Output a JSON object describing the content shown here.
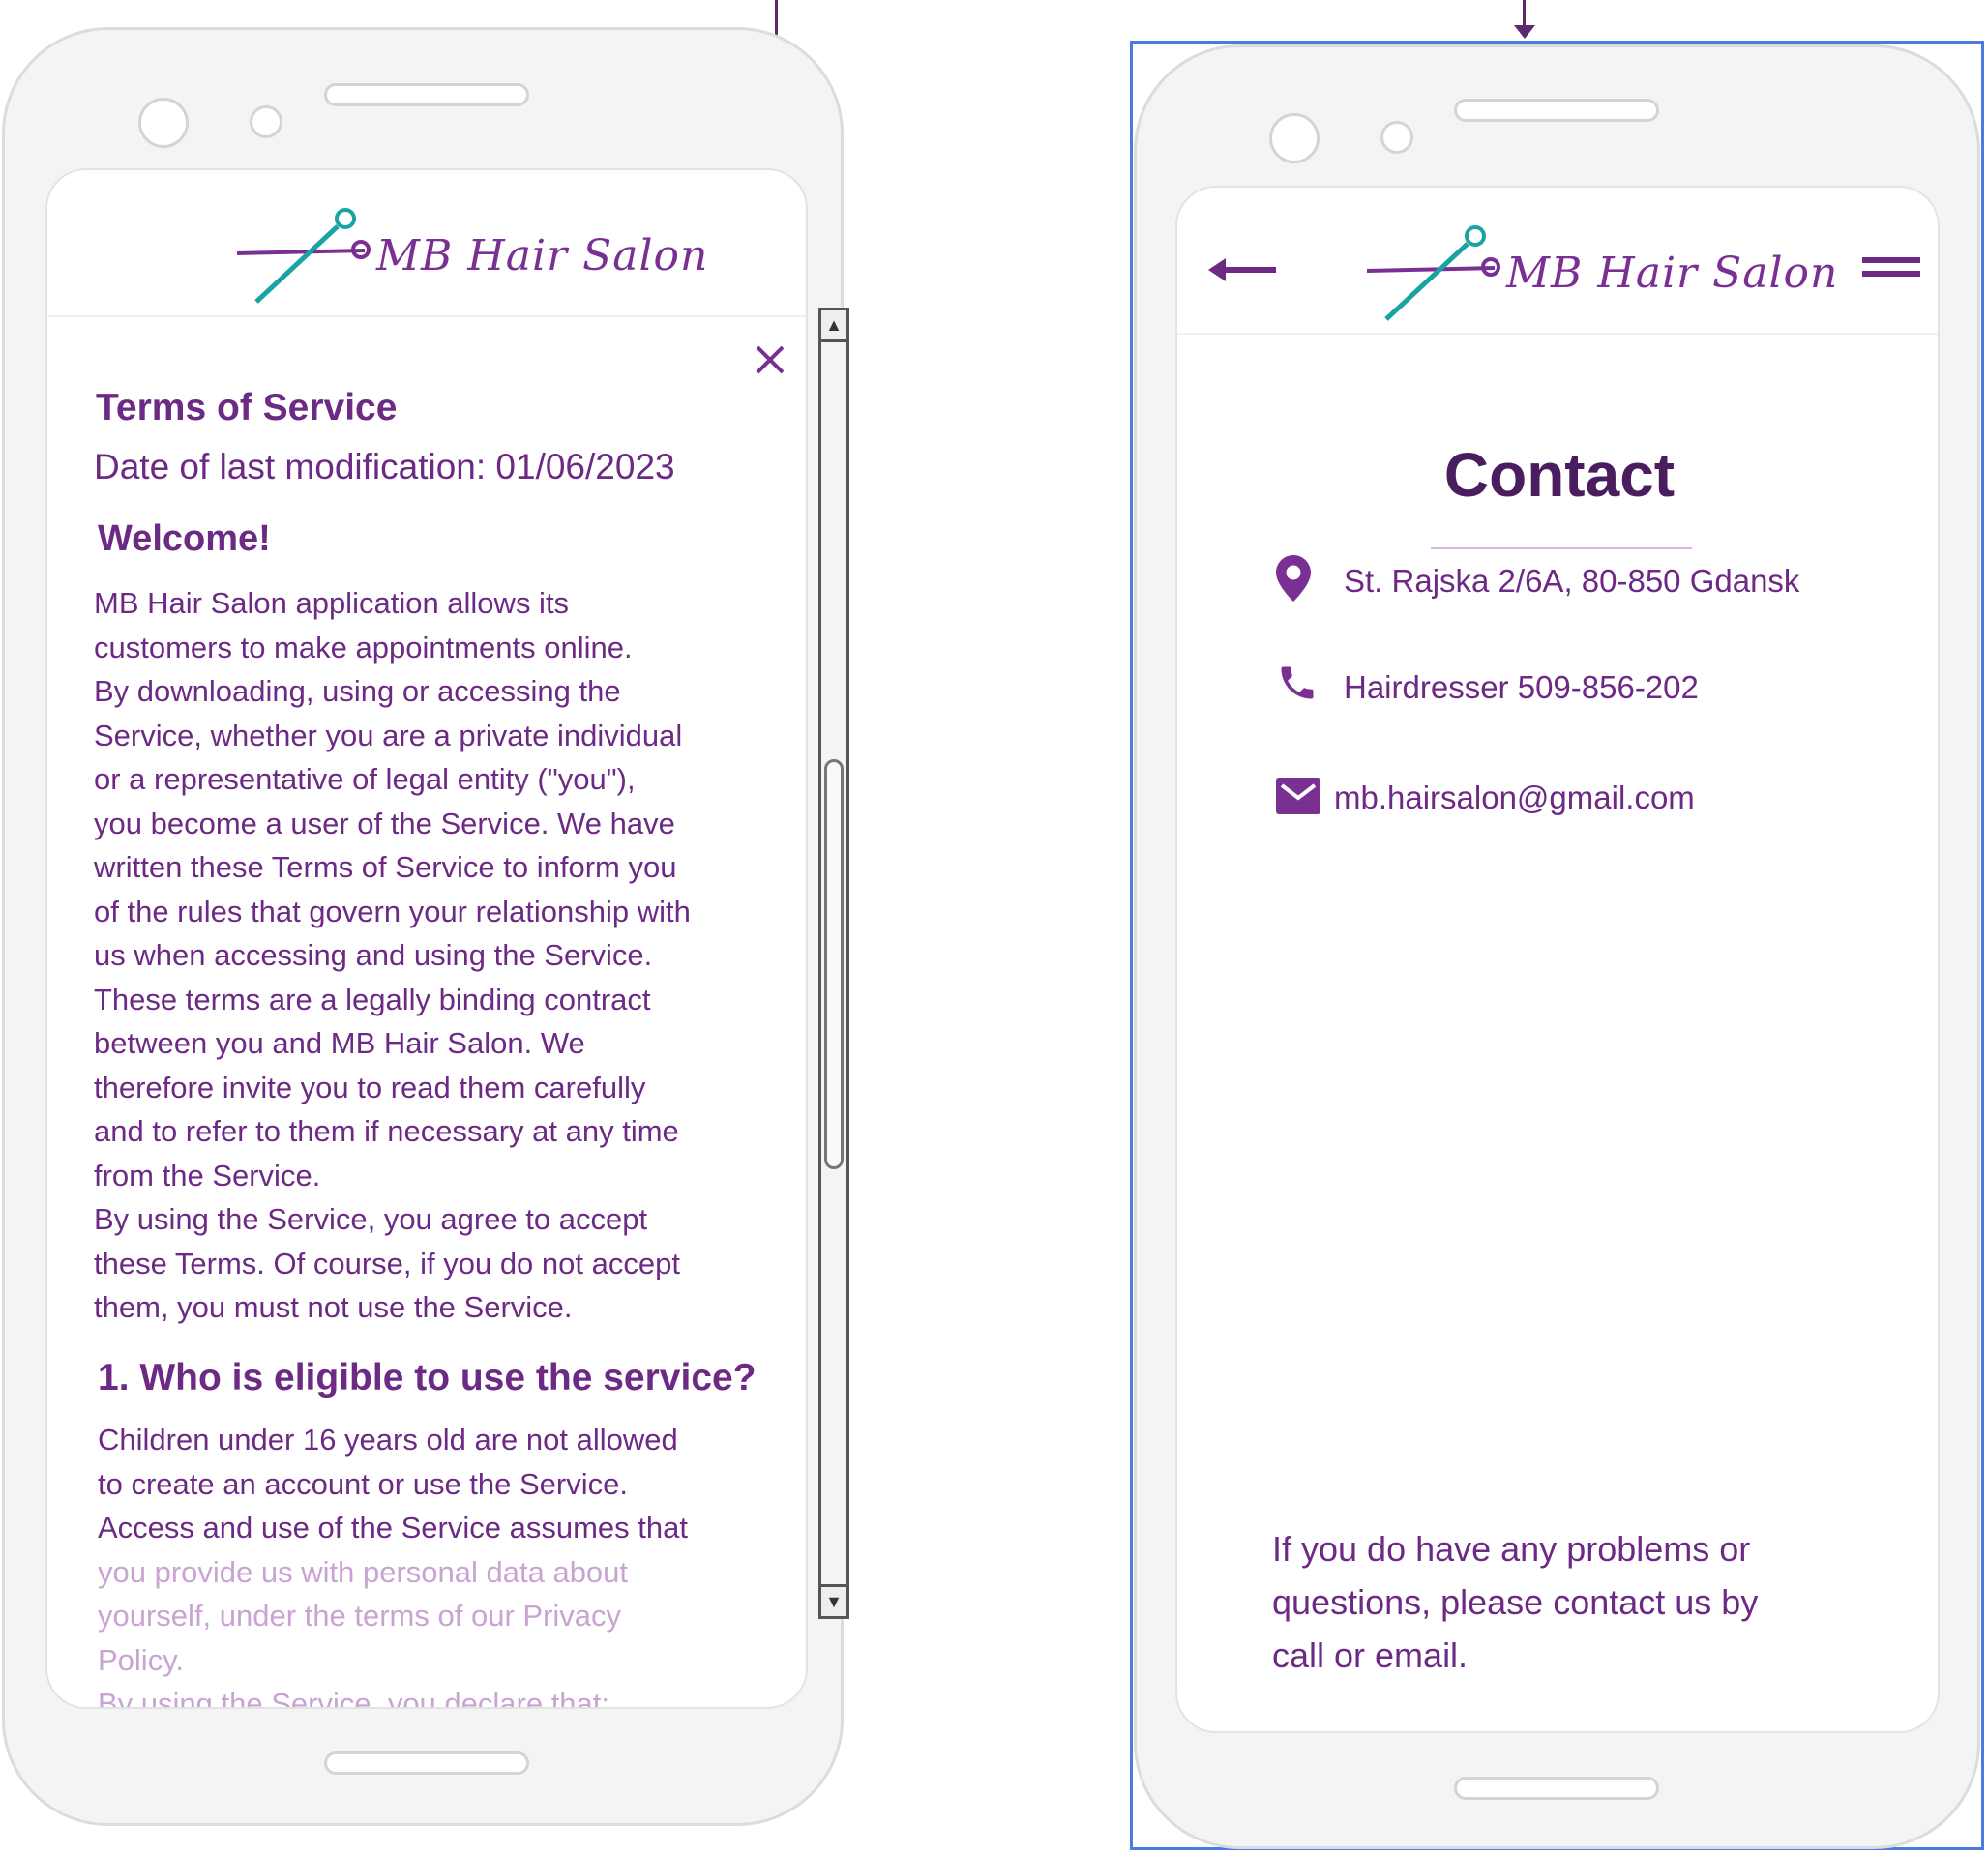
{
  "brand": {
    "logo_text": "MB Hair Salon",
    "accent": "#7a2f93",
    "teal": "#1aa3a3"
  },
  "terms_screen": {
    "title": "Terms of Service",
    "date": "Date of last modification: 01/06/2023",
    "welcome": "Welcome!",
    "body_lines": [
      "MB Hair Salon application allows its",
      "customers to make appointments online.",
      "By downloading, using or accessing the",
      "Service, whether you are a private individual",
      "or a representative of legal entity (\"you\"),",
      "you become a user of the Service. We have",
      "written these Terms of Service to inform you",
      "of the rules that govern your relationship with",
      "us when accessing and using the Service.",
      "These terms are a legally binding contract",
      "between you and MB Hair Salon. We",
      "therefore invite you to read them carefully",
      "and to refer to them if necessary at any time",
      "from the Service.",
      "By using the Service, you agree to accept",
      "these Terms. Of course, if you do not accept",
      "them, you must not use the Service."
    ],
    "section1_heading": "1. Who is eligible to use the service?",
    "section1_lines": [
      "Children under 16 years old are not allowed",
      "to create an account or use the Service.",
      "Access and use of the Service assumes that"
    ],
    "section1_faded_lines": [
      "you provide us with personal data about",
      "yourself, under the terms of our Privacy",
      "Policy.",
      "By using the Service, you declare that:"
    ],
    "close_icon": "close-icon"
  },
  "contact_screen": {
    "title": "Contact",
    "address": "St. Rajska 2/6A, 80-850 Gdansk",
    "phone": "Hairdresser 509-856-202",
    "email": "mb.hairsalon@gmail.com",
    "footer_lines": [
      "If you do have any problems or",
      "questions, please contact us by",
      "call or email."
    ],
    "icons": [
      "back-arrow-icon",
      "menu-icon",
      "location-pin-icon",
      "phone-icon",
      "mail-icon"
    ]
  }
}
